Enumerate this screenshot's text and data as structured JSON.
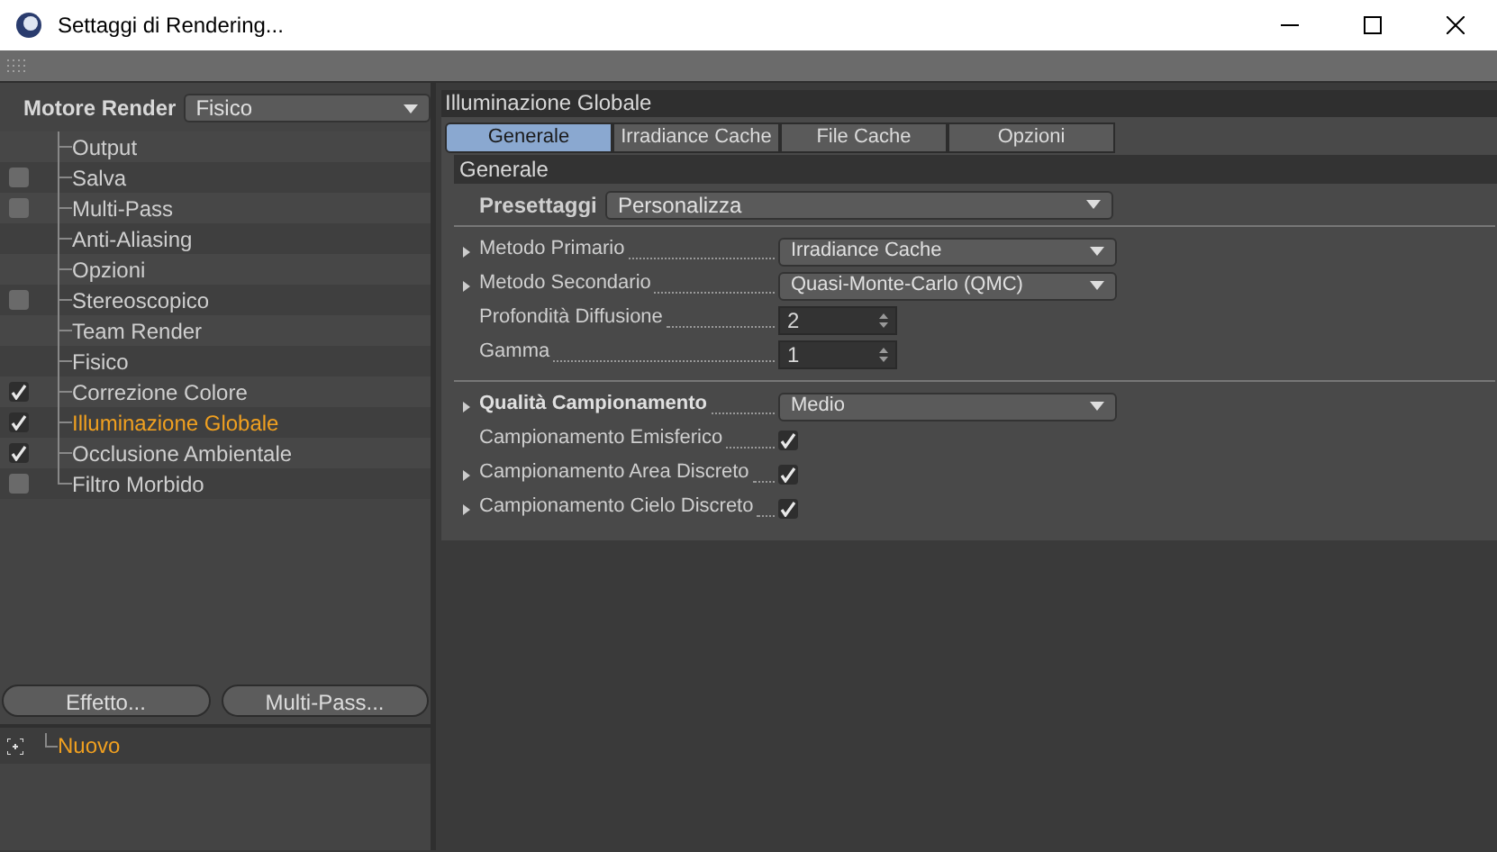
{
  "window": {
    "title": "Settaggi di Rendering..."
  },
  "renderer": {
    "label": "Motore Render",
    "value": "Fisico"
  },
  "sidebar": {
    "items": [
      {
        "label": "Output",
        "kind": "plain",
        "selected": false
      },
      {
        "label": "Salva",
        "kind": "check",
        "checked": false,
        "selected": false
      },
      {
        "label": "Multi-Pass",
        "kind": "check",
        "checked": false,
        "selected": false
      },
      {
        "label": "Anti-Aliasing",
        "kind": "plain",
        "selected": false
      },
      {
        "label": "Opzioni",
        "kind": "plain",
        "selected": false
      },
      {
        "label": "Stereoscopico",
        "kind": "check",
        "checked": false,
        "selected": false
      },
      {
        "label": "Team Render",
        "kind": "plain",
        "selected": false
      },
      {
        "label": "Fisico",
        "kind": "plain",
        "selected": false
      },
      {
        "label": "Correzione Colore",
        "kind": "check",
        "checked": true,
        "selected": false
      },
      {
        "label": "Illuminazione Globale",
        "kind": "check",
        "checked": true,
        "selected": true
      },
      {
        "label": "Occlusione Ambientale",
        "kind": "check",
        "checked": true,
        "selected": false
      },
      {
        "label": "Filtro Morbido",
        "kind": "check",
        "checked": false,
        "selected": false
      }
    ],
    "buttons": [
      "Effetto...",
      "Multi-Pass..."
    ],
    "presets": [
      {
        "label": "Nuovo"
      }
    ]
  },
  "panel": {
    "title": "Illuminazione Globale",
    "tabs": [
      {
        "label": "Generale",
        "selected": true
      },
      {
        "label": "Irradiance Cache",
        "selected": false
      },
      {
        "label": "File Cache",
        "selected": false
      },
      {
        "label": "Opzioni",
        "selected": false
      }
    ],
    "section": "Generale",
    "preset": {
      "label": "Presettaggi",
      "value": "Personalizza"
    },
    "groups": [
      [
        {
          "label": "Metodo Primario",
          "kind": "dropdown",
          "arrow": true,
          "bold": false,
          "value": "Irradiance Cache"
        },
        {
          "label": "Metodo Secondario",
          "kind": "dropdown",
          "arrow": true,
          "bold": false,
          "value": "Quasi-Monte-Carlo (QMC)"
        },
        {
          "label": "Profondità Diffusione",
          "kind": "spinner",
          "arrow": false,
          "bold": false,
          "value": "2"
        },
        {
          "label": "Gamma",
          "kind": "spinner",
          "arrow": false,
          "bold": false,
          "value": "1"
        }
      ],
      [
        {
          "label": "Qualità Campionamento",
          "kind": "dropdown",
          "arrow": true,
          "bold": true,
          "value": "Medio"
        },
        {
          "label": "Campionamento Emisferico",
          "kind": "checkbox",
          "arrow": false,
          "bold": false,
          "checked": true
        },
        {
          "label": "Campionamento Area Discreto",
          "kind": "checkbox",
          "arrow": true,
          "bold": false,
          "checked": true
        },
        {
          "label": "Campionamento Cielo Discreto",
          "kind": "checkbox",
          "arrow": true,
          "bold": false,
          "checked": true
        }
      ]
    ]
  }
}
